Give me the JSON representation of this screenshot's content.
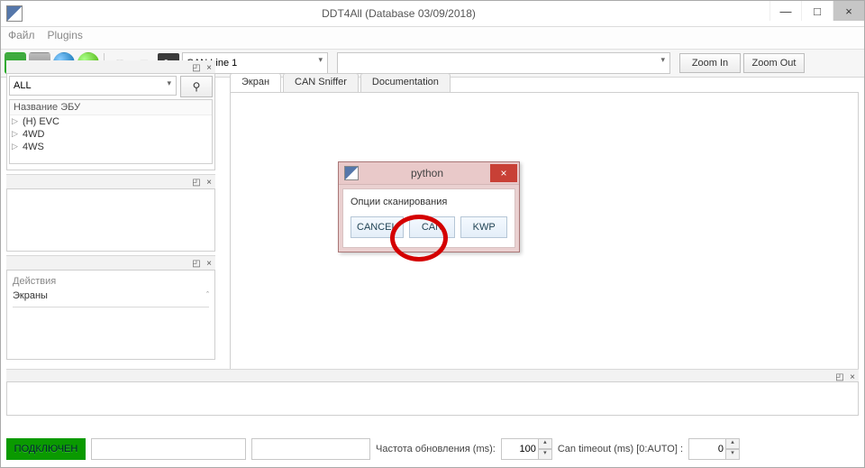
{
  "window": {
    "title": "DDT4All (Database 03/09/2018)",
    "min": "—",
    "max": "□",
    "close": "×"
  },
  "menu": {
    "file": "Файл",
    "plugins": "Plugins"
  },
  "toolbar": {
    "hex": "0x",
    "can_line": "CAN Line 1",
    "zoom_in": "Zoom In",
    "zoom_out": "Zoom Out"
  },
  "filter": {
    "all": "ALL"
  },
  "tree": {
    "header": "Название ЭБУ",
    "items": [
      "(H) EVC",
      "4WD",
      "4WS"
    ]
  },
  "actions": {
    "header": "Действия",
    "item": "Экраны"
  },
  "tabs": {
    "screen": "Экран",
    "sniffer": "CAN Sniffer",
    "docs": "Documentation"
  },
  "status": {
    "connected": "ПОДКЛЮЧЕН",
    "refresh_label": "Частота обновления (ms):",
    "refresh_value": "100",
    "timeout_label": "Can timeout (ms) [0:AUTO] :",
    "timeout_value": "0"
  },
  "dialog": {
    "title": "python",
    "message": "Опции сканирования",
    "cancel": "CANCEL",
    "can": "CAN",
    "kwp": "KWP",
    "close": "×"
  }
}
